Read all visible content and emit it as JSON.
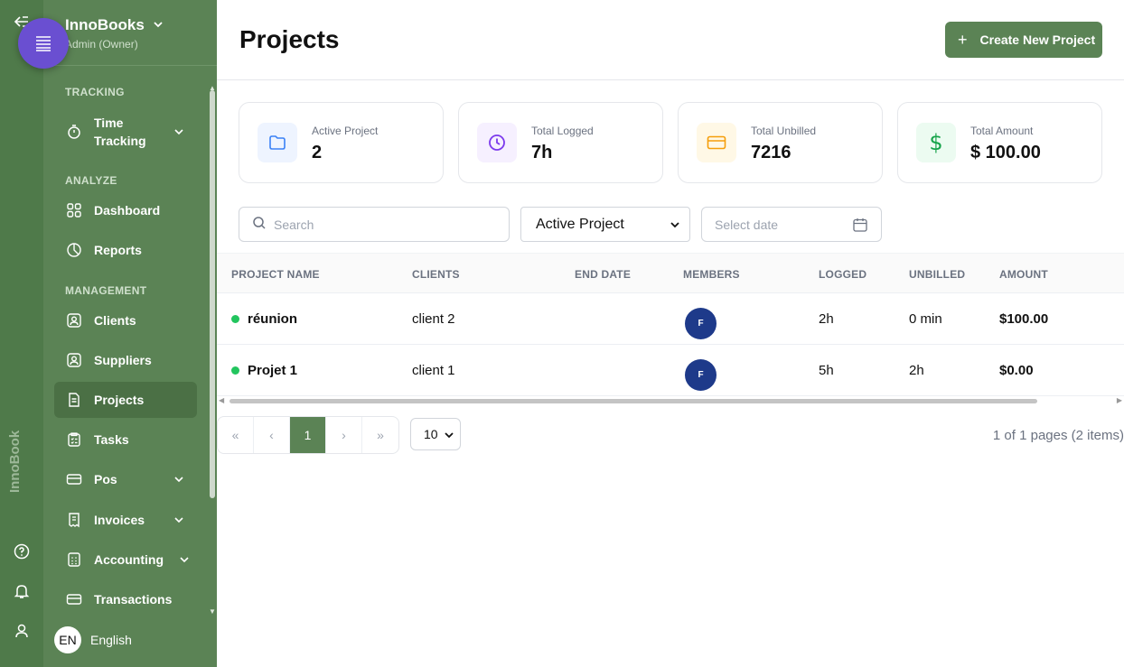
{
  "app": {
    "name": "InnoBooks",
    "role": "Admin (Owner)",
    "vertical_brand": "InnoBook"
  },
  "sidebar": {
    "sections": {
      "tracking": "TRACKING",
      "analyze": "ANALYZE",
      "management": "MANAGEMENT"
    },
    "items": [
      {
        "label": "Time Tracking",
        "icon": "stopwatch-icon",
        "expandable": true
      },
      {
        "label": "Dashboard",
        "icon": "grid-icon",
        "expandable": false
      },
      {
        "label": "Reports",
        "icon": "pie-chart-icon",
        "expandable": false
      },
      {
        "label": "Clients",
        "icon": "contact-icon",
        "expandable": false
      },
      {
        "label": "Suppliers",
        "icon": "contact-icon",
        "expandable": false
      },
      {
        "label": "Projects",
        "icon": "document-icon",
        "expandable": false,
        "active": true
      },
      {
        "label": "Tasks",
        "icon": "checklist-icon",
        "expandable": false
      },
      {
        "label": "Pos",
        "icon": "card-icon",
        "expandable": true
      },
      {
        "label": "Invoices",
        "icon": "receipt-icon",
        "expandable": true
      },
      {
        "label": "Accounting",
        "icon": "calculator-icon",
        "expandable": true
      },
      {
        "label": "Transactions",
        "icon": "card-icon",
        "expandable": false
      }
    ],
    "language": {
      "code": "EN",
      "label": "English"
    }
  },
  "header": {
    "title": "Projects",
    "create_button": "Create New Project"
  },
  "stats": [
    {
      "label": "Active Project",
      "value": "2",
      "icon": "folder-icon",
      "color": "#3b82f6",
      "bg": "#eef4ff"
    },
    {
      "label": "Total Logged",
      "value": "7h",
      "icon": "clock-icon",
      "color": "#7c3aed",
      "bg": "#f6f0ff"
    },
    {
      "label": "Total Unbilled",
      "value": "7216",
      "icon": "card-icon",
      "color": "#f59e0b",
      "bg": "#fff8e6"
    },
    {
      "label": "Total Amount",
      "value": "$ 100.00",
      "icon": "dollar-icon",
      "color": "#16a34a",
      "bg": "#ecfbf1"
    }
  ],
  "filters": {
    "search_placeholder": "Search",
    "status_selected": "Active Project",
    "date_placeholder": "Select date"
  },
  "table": {
    "columns": [
      "PROJECT NAME",
      "CLIENTS",
      "END DATE",
      "MEMBERS",
      "LOGGED",
      "UNBILLED",
      "AMOUNT"
    ],
    "rows": [
      {
        "name": "réunion",
        "client": "client 2",
        "end_date": "",
        "member": "F",
        "logged": "2h",
        "unbilled": "0 min",
        "amount": "$100.00"
      },
      {
        "name": "Projet 1",
        "client": "client 1",
        "end_date": "",
        "member": "F",
        "logged": "5h",
        "unbilled": "2h",
        "amount": "$0.00"
      }
    ]
  },
  "pagination": {
    "first": "«",
    "prev": "‹",
    "current": "1",
    "next": "›",
    "last": "»",
    "per_page": "10",
    "info": "1 of 1 pages (2 items)"
  },
  "colors": {
    "sidebar": "#5b8355",
    "rail": "#4f7a4a",
    "accent": "#5b8355",
    "fab": "#6a4fd1",
    "avatar": "#1e3a8a",
    "status_active": "#22c55e"
  }
}
